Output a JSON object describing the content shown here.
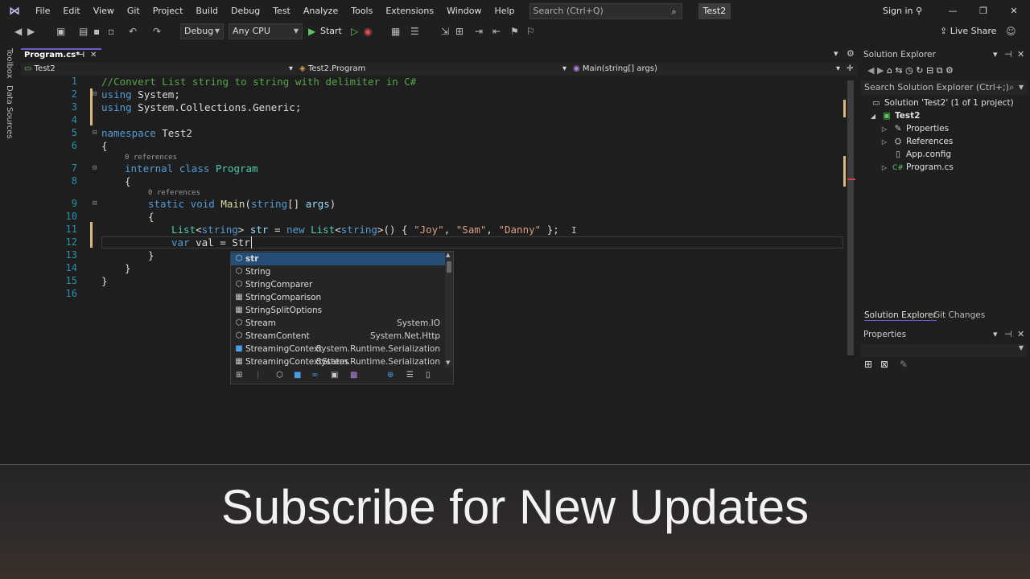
{
  "menu": [
    "File",
    "Edit",
    "View",
    "Git",
    "Project",
    "Build",
    "Debug",
    "Test",
    "Analyze",
    "Tools",
    "Extensions",
    "Window",
    "Help"
  ],
  "search": {
    "placeholder": "Search (Ctrl+Q)"
  },
  "project_badge": "Test2",
  "signin": "Sign in",
  "toolbar": {
    "config": "Debug",
    "platform": "Any CPU",
    "start": "Start",
    "liveshare": "Live Share"
  },
  "left_strip": [
    "Toolbox",
    "Data Sources"
  ],
  "editor": {
    "tab": "Program.cs*",
    "nav_project": "Test2",
    "nav_class": "Test2.Program",
    "nav_member": "Main(string[] args)",
    "line_numbers": [
      "1",
      "2",
      "3",
      "4",
      "5",
      "6",
      "7",
      "8",
      "9",
      "10",
      "11",
      "12",
      "13",
      "14",
      "15",
      "16"
    ],
    "refs_label": "0 references",
    "lines": {
      "l1": "//Convert List string to string with delimiter in C#",
      "l2a": "using",
      "l2b": " System;",
      "l3a": "using",
      "l3b": " System.Collections.Generic;",
      "l5a": "namespace",
      "l5b": " Test2",
      "l6": "{",
      "l7a": "internal",
      "l7b": " class ",
      "l7c": "Program",
      "l8": "{",
      "l9a": "static",
      "l9b": " void ",
      "l9c": "Main",
      "l9d": "(",
      "l9e": "string",
      "l9f": "[] ",
      "l9g": "args",
      ")": ")",
      "l10": "{",
      "l11a": "List",
      "l11b": "<",
      "l11c": "string",
      "l11d": "> ",
      "l11e": "str",
      " l11f": "",
      "l11rest1": " = ",
      "l11new": "new",
      "l11sp": " ",
      "l11list": "List",
      "l11lt": "<",
      "l11str": "string",
      "l11gt": ">() { ",
      "s1": "\"Joy\"",
      "comma": ", ",
      "s2": "\"Sam\"",
      "s3": "\"Danny\"",
      "l11end": " };",
      "l12a": "var",
      "l12b": " val = Str",
      "l13": "}",
      "l14": "}",
      "l15": "}"
    }
  },
  "autocomplete": {
    "items": [
      {
        "label": "str",
        "ns": "",
        "icon": "local"
      },
      {
        "label": "String",
        "ns": "",
        "icon": "class"
      },
      {
        "label": "StringComparer",
        "ns": "",
        "icon": "class"
      },
      {
        "label": "StringComparison",
        "ns": "",
        "icon": "enum"
      },
      {
        "label": "StringSplitOptions",
        "ns": "",
        "icon": "enum"
      },
      {
        "label": "Stream",
        "ns": "System.IO",
        "icon": "class"
      },
      {
        "label": "StreamContent",
        "ns": "System.Net.Http",
        "icon": "class"
      },
      {
        "label": "StreamingContext",
        "ns": "System.Runtime.Serialization",
        "icon": "struct"
      },
      {
        "label": "StreamingContextStates",
        "ns": "System.Runtime.Serialization",
        "icon": "enum"
      }
    ]
  },
  "solution_explorer": {
    "title": "Solution Explorer",
    "search_placeholder": "Search Solution Explorer (Ctrl+;)",
    "solution": "Solution 'Test2' (1 of 1 project)",
    "project": "Test2",
    "items": [
      "Properties",
      "References",
      "App.config",
      "Program.cs"
    ],
    "tabs": [
      "Solution Explorer",
      "Git Changes"
    ]
  },
  "properties": {
    "title": "Properties"
  },
  "banner": "Subscribe for New Updates"
}
